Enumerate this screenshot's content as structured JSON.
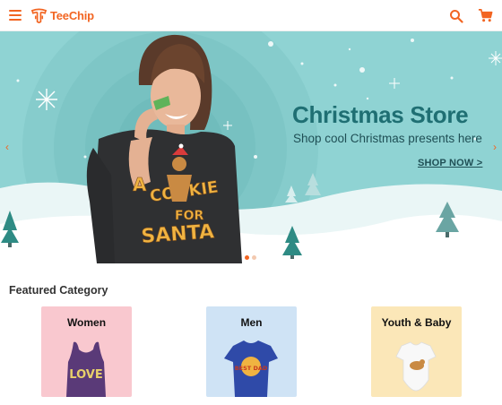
{
  "header": {
    "brand_name": "TeeChip",
    "brand_color": "#f26522",
    "icons": [
      "menu-icon",
      "search-icon",
      "cart-icon"
    ]
  },
  "hero": {
    "title": "Christmas Store",
    "subtitle": "Shop cool Christmas presents here",
    "cta_label": "SHOP NOW >",
    "shirt_text": "A COOKIE FOR SANTA",
    "slides_total": 2,
    "active_slide": 1,
    "colors": {
      "title": "#1f6f73",
      "background": "#8fd3d3"
    }
  },
  "featured": {
    "title": "Featured Category",
    "categories": [
      {
        "label": "Women",
        "bg": "#f9c8cf",
        "product_text": "LOVE"
      },
      {
        "label": "Men",
        "bg": "#cfe3f5",
        "product_text": "BEST DAD"
      },
      {
        "label": "Youth & Baby",
        "bg": "#fbe7b8"
      }
    ]
  }
}
